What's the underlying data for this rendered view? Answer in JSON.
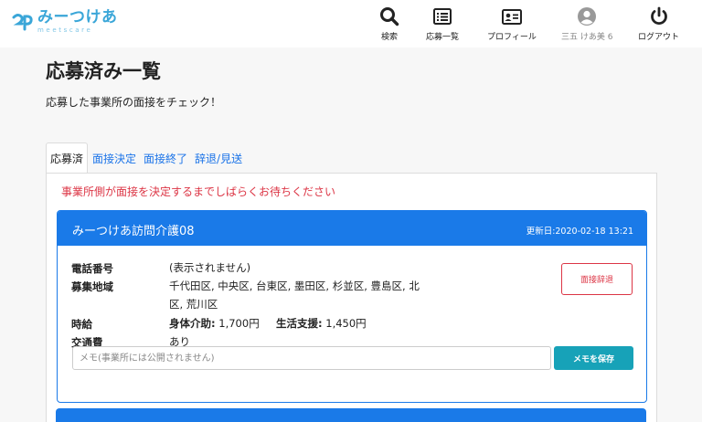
{
  "header": {
    "logo_text": "みーつけあ",
    "logo_sub": "meetscare",
    "nav": [
      {
        "id": "search",
        "label": "検索",
        "icon": "search-icon"
      },
      {
        "id": "applied",
        "label": "応募一覧",
        "icon": "list-icon"
      },
      {
        "id": "profile",
        "label": "プロフィール",
        "icon": "id-card-icon"
      },
      {
        "id": "user",
        "label": "三五 けあ美 6",
        "icon": "user-avatar-icon"
      },
      {
        "id": "logout",
        "label": "ログアウト",
        "icon": "power-icon"
      }
    ]
  },
  "page": {
    "title": "応募済み一覧",
    "subtitle": "応募した事業所の面接をチェック！"
  },
  "tabs": [
    {
      "label": "応募済",
      "active": true
    },
    {
      "label": "面接決定",
      "active": false
    },
    {
      "label": "面接終了",
      "active": false
    },
    {
      "label": "辞退/見送",
      "active": false
    }
  ],
  "notice": "事業所側が面接を決定するまでしばらくお待ちください",
  "card": {
    "title": "みーつけあ訪問介護08",
    "updated": "更新日:2020-02-18 13:21",
    "phone_label": "電話番号",
    "phone_value": "(表示されません)",
    "area_label": "募集地域",
    "area_line1": "千代田区, 中央区, 台東区, 墨田区, 杉並区, 豊島区, 北",
    "area_line2": "区, 荒川区",
    "wage_label": "時給",
    "wage_body_label": "身体介助:",
    "wage_body_value": "1,700円",
    "wage_life_label": "生活支援:",
    "wage_life_value": "1,450円",
    "transport_label": "交通費",
    "transport_value": "あり",
    "decline_label": "面接辞退",
    "memo_placeholder": "メモ(事業所には公開されません)",
    "save_label": "メモを保存"
  },
  "colors": {
    "brand": "#3aa6d8",
    "primary": "#1a7ae8",
    "danger": "#dc3545",
    "info": "#17a2b8"
  }
}
